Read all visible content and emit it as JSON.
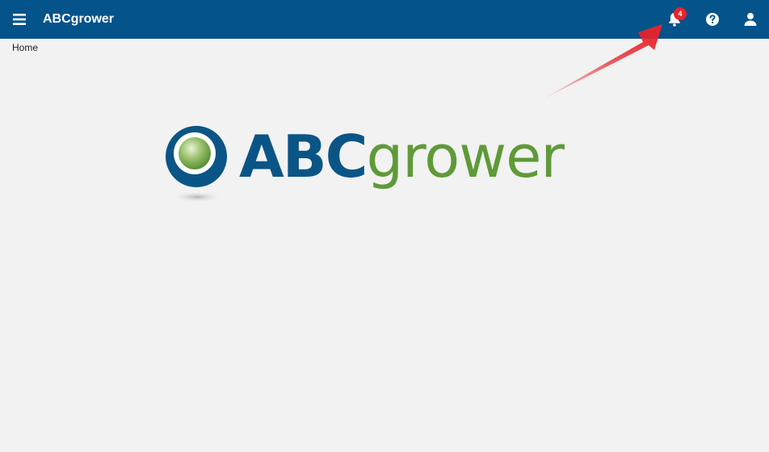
{
  "header": {
    "title": "ABCgrower",
    "menu_icon": "hamburger-icon",
    "notifications": {
      "icon": "bell-icon",
      "count": "4"
    },
    "help_icon": "question-circle-icon",
    "user_icon": "user-icon"
  },
  "breadcrumb": {
    "current": "Home"
  },
  "logo": {
    "part1": "ABC",
    "part2": "grower"
  },
  "colors": {
    "header_bg": "#04538a",
    "page_bg": "#f2f2f2",
    "badge": "#e8232a",
    "logo_blue": "#0b5586",
    "logo_green": "#5f9a38",
    "annotation_arrow": "#e8232a"
  }
}
